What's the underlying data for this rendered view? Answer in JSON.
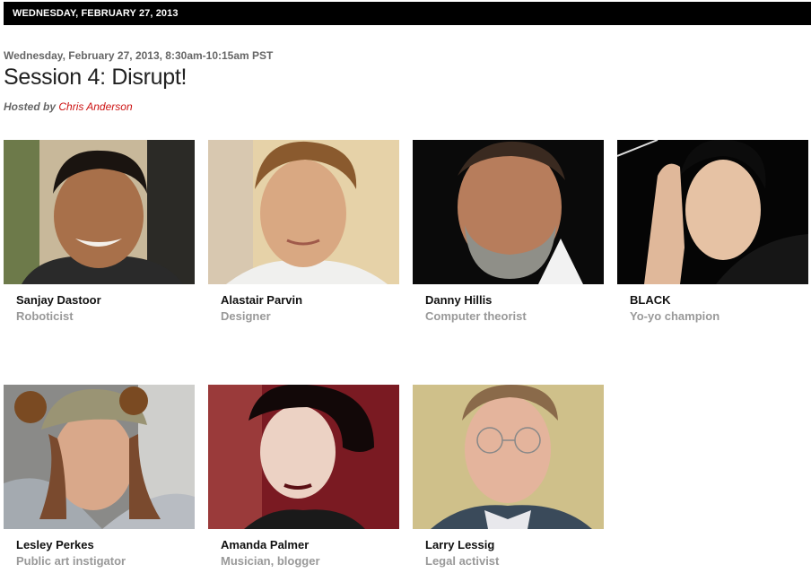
{
  "header": {
    "date_bar": "WEDNESDAY, FEBRUARY 27, 2013"
  },
  "session": {
    "time": "Wednesday, February 27, 2013, 8:30am-10:15am PST",
    "title": "Session 4: Disrupt!",
    "hosted_by_label": "Hosted by",
    "host_name": "Chris Anderson"
  },
  "speakers": [
    {
      "name": "Sanjay Dastoor",
      "role": "Roboticist"
    },
    {
      "name": "Alastair Parvin",
      "role": "Designer"
    },
    {
      "name": "Danny Hillis",
      "role": "Computer theorist"
    },
    {
      "name": "BLACK",
      "role": "Yo-yo champion"
    },
    {
      "name": "Lesley Perkes",
      "role": "Public art instigator"
    },
    {
      "name": "Amanda Palmer",
      "role": "Musician, blogger"
    },
    {
      "name": "Larry Lessig",
      "role": "Legal activist"
    }
  ]
}
